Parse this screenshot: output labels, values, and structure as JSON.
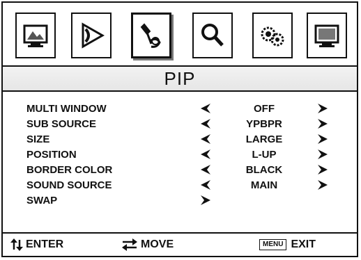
{
  "tabs": [
    {
      "name": "picture",
      "icon": "monitor-picture-icon"
    },
    {
      "name": "sound",
      "icon": "speaker-icon"
    },
    {
      "name": "pip",
      "icon": "pip-tools-icon",
      "active": true
    },
    {
      "name": "search",
      "icon": "search-icon"
    },
    {
      "name": "setup",
      "icon": "gears-icon"
    },
    {
      "name": "input",
      "icon": "monitor-input-icon"
    }
  ],
  "title": "PIP",
  "menu": {
    "rows": [
      {
        "label": "MULTI WINDOW",
        "value": "OFF"
      },
      {
        "label": "SUB SOURCE",
        "value": "YPBPR"
      },
      {
        "label": "SIZE",
        "value": "LARGE"
      },
      {
        "label": "POSITION",
        "value": "L-UP"
      },
      {
        "label": "BORDER COLOR",
        "value": "BLACK"
      },
      {
        "label": "SOUND SOURCE",
        "value": "MAIN"
      }
    ],
    "swap_label": "SWAP"
  },
  "footer": {
    "enter_label": "ENTER",
    "move_label": "MOVE",
    "menu_key": "MENU",
    "exit_label": "EXIT"
  }
}
